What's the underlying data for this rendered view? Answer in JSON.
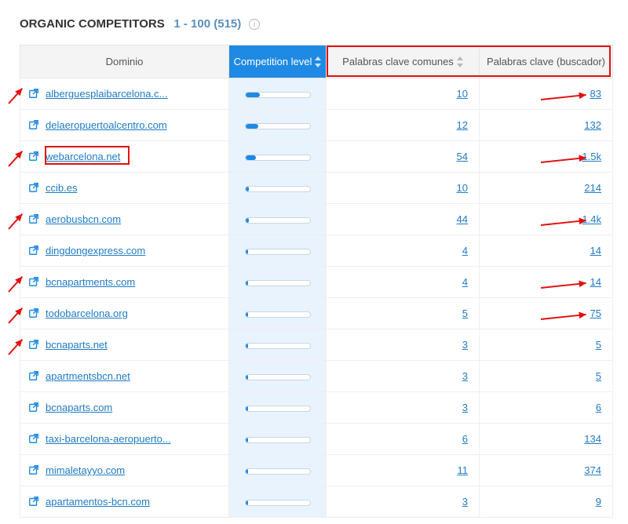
{
  "heading": {
    "title": "ORGANIC COMPETITORS",
    "range": "1 - 100 (515)"
  },
  "columns": {
    "domain": "Dominio",
    "competition": "Competition level",
    "common": "Palabras clave comunes",
    "se": "Palabras clave (buscador)"
  },
  "rows": [
    {
      "domain": "alberguesplaibarcelona.c...",
      "comp": 22,
      "common": "10",
      "se": "83"
    },
    {
      "domain": "delaeropuertoalcentro.com",
      "comp": 20,
      "common": "12",
      "se": "132"
    },
    {
      "domain": "webarcelona.net",
      "comp": 16,
      "common": "54",
      "se": "1.5k"
    },
    {
      "domain": "ccib.es",
      "comp": 6,
      "common": "10",
      "se": "214"
    },
    {
      "domain": "aerobusbcn.com",
      "comp": 5,
      "common": "44",
      "se": "1.4k"
    },
    {
      "domain": "dingdongexpress.com",
      "comp": 4,
      "common": "4",
      "se": "14"
    },
    {
      "domain": "bcnapartments.com",
      "comp": 4,
      "common": "4",
      "se": "14"
    },
    {
      "domain": "todobarcelona.org",
      "comp": 4,
      "common": "5",
      "se": "75"
    },
    {
      "domain": "bcnaparts.net",
      "comp": 4,
      "common": "3",
      "se": "5"
    },
    {
      "domain": "apartmentsbcn.net",
      "comp": 4,
      "common": "3",
      "se": "5"
    },
    {
      "domain": "bcnaparts.com",
      "comp": 4,
      "common": "3",
      "se": "6"
    },
    {
      "domain": "taxi-barcelona-aeropuerto...",
      "comp": 4,
      "common": "6",
      "se": "134"
    },
    {
      "domain": "mimaletayyo.com",
      "comp": 4,
      "common": "11",
      "se": "374"
    },
    {
      "domain": "apartamentos-bcn.com",
      "comp": 4,
      "common": "3",
      "se": "9"
    }
  ],
  "annotations": {
    "red_boxes": [
      {
        "target": "header-right-cols"
      },
      {
        "target": "domain-row-2"
      }
    ],
    "arrows_left_rows": [
      0,
      2,
      4,
      6,
      7,
      8
    ],
    "arrows_right_rows": [
      0,
      2,
      4,
      6,
      7
    ]
  },
  "chart_data": {
    "type": "table",
    "title": "ORGANIC COMPETITORS 1 - 100 (515)",
    "columns": [
      "Dominio",
      "Competition level (bar %)",
      "Palabras clave comunes",
      "Palabras clave (buscador)"
    ],
    "rows": [
      [
        "alberguesplaibarcelona.c...",
        22,
        10,
        83
      ],
      [
        "delaeropuertoalcentro.com",
        20,
        12,
        132
      ],
      [
        "webarcelona.net",
        16,
        54,
        1500
      ],
      [
        "ccib.es",
        6,
        10,
        214
      ],
      [
        "aerobusbcn.com",
        5,
        44,
        1400
      ],
      [
        "dingdongexpress.com",
        4,
        4,
        14
      ],
      [
        "bcnapartments.com",
        4,
        4,
        14
      ],
      [
        "todobarcelona.org",
        4,
        5,
        75
      ],
      [
        "bcnaparts.net",
        4,
        3,
        5
      ],
      [
        "apartmentsbcn.net",
        4,
        3,
        5
      ],
      [
        "bcnaparts.com",
        4,
        3,
        6
      ],
      [
        "taxi-barcelona-aeropuerto...",
        4,
        6,
        134
      ],
      [
        "mimaletayyo.com",
        4,
        11,
        374
      ],
      [
        "apartamentos-bcn.com",
        4,
        3,
        9
      ]
    ]
  }
}
